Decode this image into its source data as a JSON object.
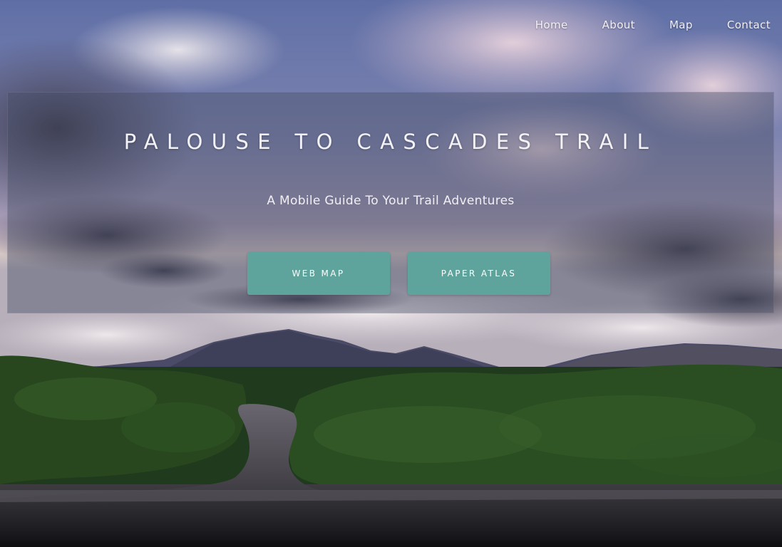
{
  "nav": {
    "items": [
      {
        "label": "Home"
      },
      {
        "label": "About"
      },
      {
        "label": "Map"
      },
      {
        "label": "Contact"
      }
    ]
  },
  "hero": {
    "title": "PALOUSE TO CASCADES TRAIL",
    "subtitle": "A Mobile Guide To Your Trail Adventures",
    "buttons": {
      "web_map": "WEB MAP",
      "paper_atlas": "PAPER ATLAS"
    }
  },
  "colors": {
    "button_bg": "#5ea39c",
    "panel_bg": "rgba(70,76,100,0.42)",
    "text": "#f3f2f6"
  }
}
